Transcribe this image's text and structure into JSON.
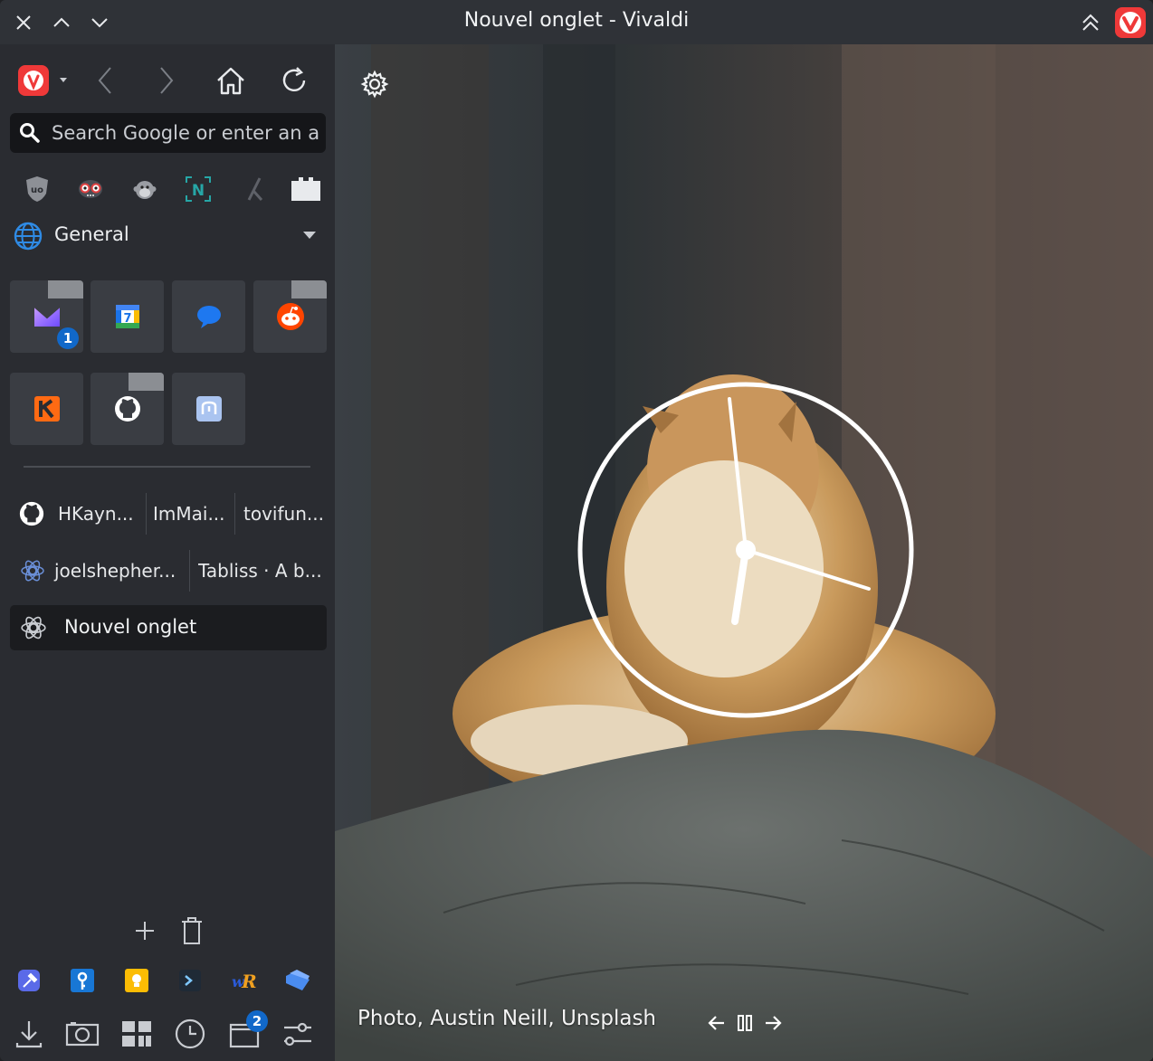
{
  "window": {
    "title": "Nouvel onglet - Vivaldi",
    "brand_color": "#ef3939"
  },
  "toolbar": {
    "icons": [
      "vivaldi-menu-icon",
      "back-icon",
      "forward-icon",
      "home-icon",
      "reload-icon"
    ]
  },
  "search": {
    "placeholder": "Search Google or enter an a..."
  },
  "extensions": [
    "ublock-icon",
    "privacy-badger-icon",
    "tampermonkey-icon",
    "notion-icon",
    "tool-icon",
    "extensions-puzzle-icon"
  ],
  "workspace": {
    "label": "General"
  },
  "pinned_tiles": {
    "mail_badge": "1",
    "calendar_day": "7"
  },
  "tabs": {
    "row1": [
      "HKayn...",
      "ImMai...",
      "tovifun..."
    ],
    "row2": [
      "joelshepher...",
      "Tabliss · A b..."
    ],
    "active": "Nouvel onglet"
  },
  "panel_bottom": {
    "window_badge": "2"
  },
  "background": {
    "credit": "Photo, Austin Neill, Unsplash"
  }
}
